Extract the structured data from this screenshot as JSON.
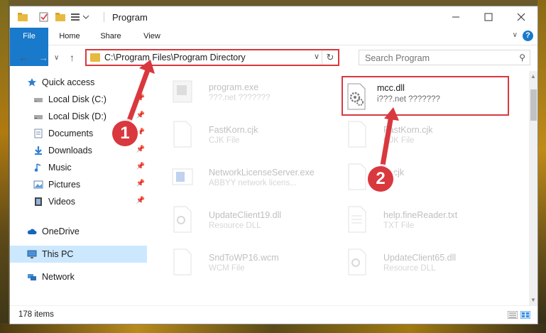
{
  "window": {
    "title": "Program"
  },
  "ribbon": {
    "tabs": [
      "File",
      "Home",
      "Share",
      "View"
    ],
    "help": "?"
  },
  "address": {
    "path": "C:\\Program Files\\Program Directory",
    "search_placeholder": "Search Program"
  },
  "sidebar": {
    "items": [
      {
        "label": "Quick access",
        "icon": "star-icon",
        "pinned": false
      },
      {
        "label": "Local Disk (C:)",
        "icon": "drive-icon",
        "pinned": true
      },
      {
        "label": "Local Disk (D:)",
        "icon": "drive-icon",
        "pinned": true
      },
      {
        "label": "Documents",
        "icon": "documents-icon",
        "pinned": true
      },
      {
        "label": "Downloads",
        "icon": "download-icon",
        "pinned": true
      },
      {
        "label": "Music",
        "icon": "music-icon",
        "pinned": true
      },
      {
        "label": "Pictures",
        "icon": "pictures-icon",
        "pinned": true
      },
      {
        "label": "Videos",
        "icon": "videos-icon",
        "pinned": true
      },
      {
        "label": "OneDrive",
        "icon": "cloud-icon",
        "pinned": false
      },
      {
        "label": "This PC",
        "icon": "computer-icon",
        "pinned": false
      },
      {
        "label": "Network",
        "icon": "network-icon",
        "pinned": false
      }
    ],
    "selected": "This PC"
  },
  "files": [
    {
      "name": "program.exe",
      "type": "???.net ???????",
      "faded": true
    },
    {
      "name": "mcc.dll",
      "type": "i???.net ???????",
      "faded": false,
      "highlighted": true
    },
    {
      "name": "FastKorn.cjk",
      "type": "CJK File",
      "faded": true
    },
    {
      "name": "FastKorn.cjk",
      "type": "CJK File",
      "faded": true
    },
    {
      "name": "NetworkLicenseServer.exe",
      "type": "ABBYY network licens...",
      "faded": true
    },
    {
      "name": "....cjk",
      "type": "",
      "faded": true
    },
    {
      "name": "UpdateClient19.dll",
      "type": "Resource DLL",
      "faded": true
    },
    {
      "name": "help.fineReader.txt",
      "type": "TXT File",
      "faded": true
    },
    {
      "name": "SndToWP16.wcm",
      "type": "WCM File",
      "faded": true
    },
    {
      "name": "UpdateClient65.dll",
      "type": "Resource DLL",
      "faded": true
    }
  ],
  "status": {
    "item_count": "178 items"
  },
  "annotations": {
    "badge1": "1",
    "badge2": "2",
    "accent": "#d9383e"
  }
}
